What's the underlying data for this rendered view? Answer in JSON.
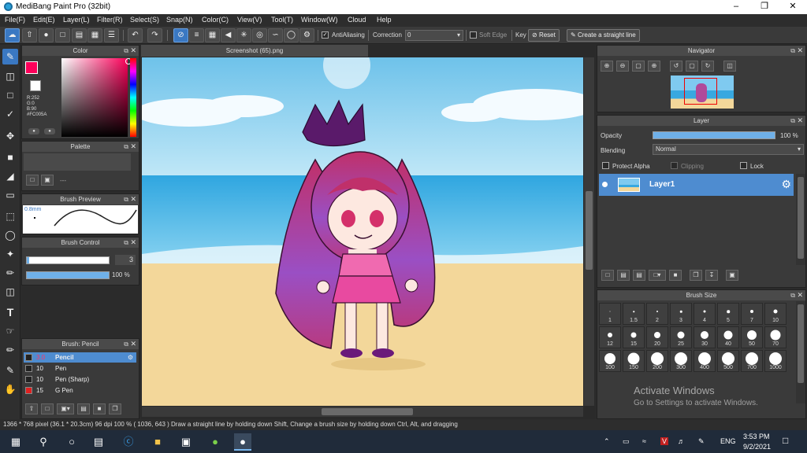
{
  "app": {
    "title": "MediBang Paint Pro (32bit)"
  },
  "menu": [
    "File(F)",
    "Edit(E)",
    "Layer(L)",
    "Filter(R)",
    "Select(S)",
    "Snap(N)",
    "Color(C)",
    "View(V)",
    "Tool(T)",
    "Window(W)",
    "Cloud",
    "Help"
  ],
  "toolbar": {
    "antialiasing": "AntiAliasing",
    "correction_label": "Correction",
    "correction_value": "0",
    "soft_edge": "Soft Edge",
    "key_label": "Key",
    "reset": "Reset",
    "straight_line": "Create a straight line"
  },
  "color_panel": {
    "title": "Color",
    "r": "R:252",
    "g": "G:0",
    "b": "B:90",
    "hex": "#FC005A",
    "fg_color": "#fc005a"
  },
  "palette_panel": {
    "title": "Palette",
    "placeholder": "---"
  },
  "brush_preview": {
    "title": "Brush Preview",
    "size": "0.8mm"
  },
  "brush_control": {
    "title": "Brush Control",
    "size": "3",
    "opacity": "100 %",
    "opacity_fraction": 1.0
  },
  "brush_list": {
    "title": "Brush: Pencil",
    "items": [
      {
        "size": "3.0",
        "name": "Pencil",
        "color": "#222222"
      },
      {
        "size": "10",
        "name": "Pen",
        "color": "#222222"
      },
      {
        "size": "10",
        "name": "Pen (Sharp)",
        "color": "#222222"
      },
      {
        "size": "15",
        "name": "G Pen",
        "color": "#e02020"
      }
    ]
  },
  "canvas": {
    "doc_title": "Screenshot (65).png"
  },
  "navigator": {
    "title": "Navigator"
  },
  "layer_panel": {
    "title": "Layer",
    "opacity_label": "Opacity",
    "opacity_value": "100 %",
    "opacity_fraction": 1.0,
    "blending_label": "Blending",
    "blending_value": "Normal",
    "protect_alpha": "Protect Alpha",
    "clipping": "Clipping",
    "lock": "Lock",
    "layer_name": "Layer1"
  },
  "brush_size": {
    "title": "Brush Size",
    "sizes": [
      "1",
      "1.5",
      "2",
      "3",
      "4",
      "5",
      "7",
      "10",
      "12",
      "15",
      "20",
      "25",
      "30",
      "40",
      "50",
      "70",
      "100",
      "150",
      "200",
      "300",
      "400",
      "500",
      "700",
      "1000"
    ]
  },
  "watermark": {
    "line1": "Activate Windows",
    "line2": "Go to Settings to activate Windows."
  },
  "status": "1366 * 768 pixel   (36.1 * 20.3cm)   96 dpi   100 %   ( 1036, 643 )   Draw a straight line by holding down Shift, Change a brush size by holding down Ctrl, Alt, and dragging",
  "taskbar": {
    "lang": "ENG",
    "time": "3:53 PM",
    "date": "9/2/2021"
  }
}
